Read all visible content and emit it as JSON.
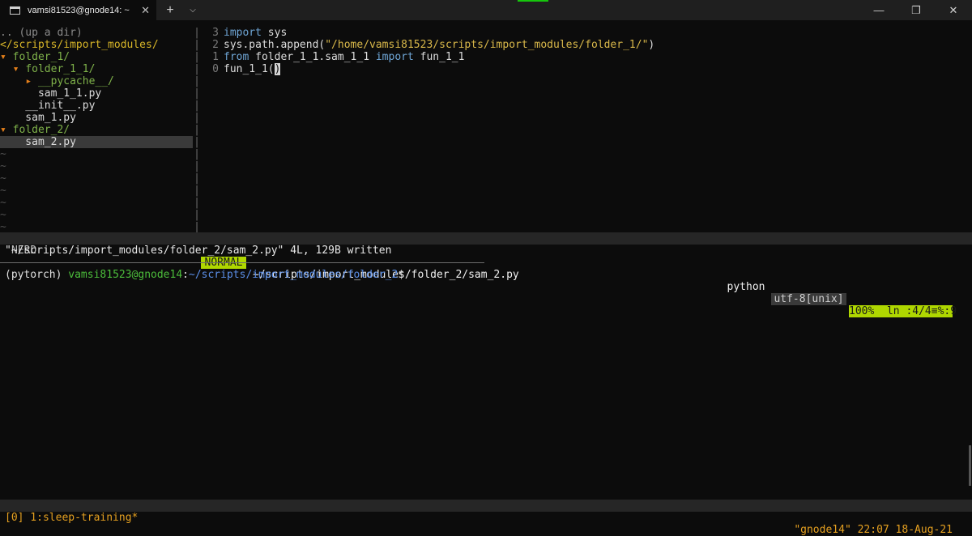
{
  "titlebar": {
    "tab_title": "vamsi81523@gnode14: ~",
    "tab_close": "✕",
    "new_tab": "+",
    "dropdown": "⌵",
    "minimize": "—",
    "maximize": "❐",
    "close": "✕"
  },
  "nerdtree": {
    "up_dir": ".. (up a dir)",
    "root": "</scripts/import_modules/",
    "items": [
      {
        "text": "▾ folder_1/"
      },
      {
        "text": "  ▾ folder_1_1/"
      },
      {
        "text": "    ▸ __pycache__/"
      },
      {
        "text": "      sam_1_1.py"
      },
      {
        "text": "    __init__.py"
      },
      {
        "text": "    sam_1.py"
      },
      {
        "text": "▾ folder_2/"
      },
      {
        "text": "    sam_2.py"
      }
    ],
    "empty_marker": "~"
  },
  "divider_char": "|",
  "editor": {
    "lines": [
      {
        "num": "3",
        "kw": "import",
        "rest": " sys"
      },
      {
        "num": "2",
        "pre": "sys.path.append(",
        "str": "\"/home/vamsi81523/scripts/import_modules/folder_1/\"",
        "post": ")"
      },
      {
        "num": "1",
        "kw": "from",
        "mid": " folder_1_1.sam_1_1 ",
        "kw2": "import",
        "rest": " fun_1_1"
      },
      {
        "num": "0",
        "pre": "fun_1_1(",
        "cur": ")",
        "post": ""
      }
    ]
  },
  "statusline": {
    "nerd": "NERD",
    "mode": "NORMAL",
    "filename": "~/scripts/import_modules/folder_2/sam_2.py",
    "filetype": "python",
    "encoding": "utf-8[unix]",
    "position": "100%  ln :4/4≡%:9"
  },
  "message": "\"~/scripts/import_modules/folder_2/sam_2.py\" 4L, 129B written",
  "shell": {
    "env": "(pytorch) ",
    "user": "vamsi81523@gnode14",
    "colon": ":",
    "path": "~/scripts/import_modules/folder_2",
    "dollar": "$"
  },
  "tmux": {
    "left": "[0] 1:sleep-training*",
    "right": "\"gnode14\" 22:07 18-Aug-21"
  },
  "colors": {
    "accent_green": "#16c60c",
    "mode_bg": "#afd700",
    "tmux_fg": "#e5a020",
    "keyword": "#6fa6d6",
    "string": "#d9b84a"
  }
}
